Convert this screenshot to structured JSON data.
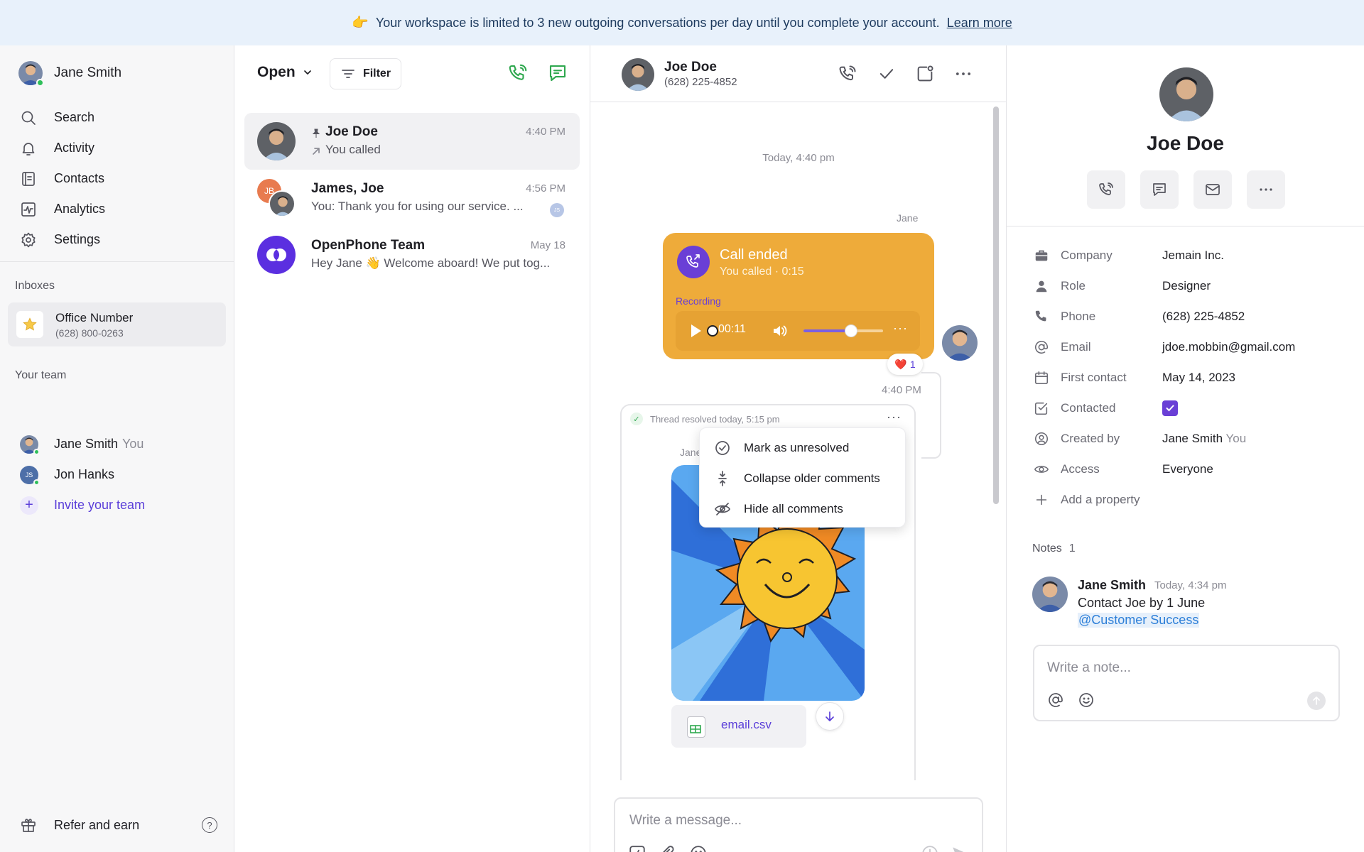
{
  "banner": {
    "emoji": "👉",
    "text": "Your workspace is limited to 3 new outgoing conversations per day until you complete your account.",
    "link": "Learn more"
  },
  "sidebar": {
    "user_name": "Jane Smith",
    "nav": [
      {
        "label": "Search",
        "icon": "search-icon"
      },
      {
        "label": "Activity",
        "icon": "bell-icon"
      },
      {
        "label": "Contacts",
        "icon": "contacts-book-icon"
      },
      {
        "label": "Analytics",
        "icon": "analytics-icon"
      },
      {
        "label": "Settings",
        "icon": "gear-icon"
      }
    ],
    "inboxes_label": "Inboxes",
    "inbox": {
      "name": "Office Number",
      "number": "(628) 800-0263",
      "icon": "star-icon"
    },
    "team_label": "Your team",
    "team": [
      {
        "name": "Jane Smith",
        "suffix": "You",
        "initials": ""
      },
      {
        "name": "Jon Hanks",
        "suffix": "",
        "initials": "JS"
      }
    ],
    "invite_label": "Invite your team",
    "refer_label": "Refer and earn",
    "help_glyph": "?"
  },
  "convlist": {
    "status_label": "Open",
    "filter_label": "Filter",
    "conversations": [
      {
        "name": "Joe Doe",
        "time": "4:40 PM",
        "preview": "You called",
        "pinned": true
      },
      {
        "name": "James, Joe",
        "time": "4:56 PM",
        "preview": "You: Thank you for using our service. ...",
        "initials": "JB",
        "mini_initials": "JS"
      },
      {
        "name": "OpenPhone Team",
        "time": "May 18",
        "preview": "Hey Jane 👋 Welcome aboard! We put tog..."
      }
    ]
  },
  "chat": {
    "contact_name": "Joe Doe",
    "contact_phone": "(628) 225-4852",
    "day_stamp": "Today, 4:40 pm",
    "sender_label": "Jane",
    "call": {
      "title": "Call ended",
      "subtitle": "You called · 0:15",
      "recording_label": "Recording",
      "elapsed": "00:11",
      "progress": 0.0,
      "volume": 0.6
    },
    "reaction": {
      "emoji": "❤️",
      "count": "1"
    },
    "message_time": "4:40 PM",
    "thread": {
      "status": "Thread resolved today, 5:15 pm",
      "sender_label": "Jane",
      "file_name": "email.csv"
    },
    "menu": [
      {
        "label": "Mark as unresolved",
        "icon": "check-circle-icon"
      },
      {
        "label": "Collapse older comments",
        "icon": "collapse-icon"
      },
      {
        "label": "Hide all comments",
        "icon": "eye-off-icon"
      }
    ],
    "composer_placeholder": "Write a message..."
  },
  "contact": {
    "name": "Joe Doe",
    "properties": [
      {
        "label": "Company",
        "value": "Jemain Inc.",
        "icon": "briefcase-icon"
      },
      {
        "label": "Role",
        "value": "Designer",
        "icon": "person-icon"
      },
      {
        "label": "Phone",
        "value": "(628) 225-4852",
        "icon": "phone-icon"
      },
      {
        "label": "Email",
        "value": "jdoe.mobbin@gmail.com",
        "icon": "at-icon"
      },
      {
        "label": "First contact",
        "value": "May 14, 2023",
        "icon": "calendar-icon"
      },
      {
        "label": "Contacted",
        "value": "",
        "checked": true,
        "icon": "checkbox-icon"
      },
      {
        "label": "Created by",
        "value": "Jane Smith",
        "suffix": "You",
        "icon": "user-circle-icon"
      },
      {
        "label": "Access",
        "value": "Everyone",
        "icon": "eye-icon"
      },
      {
        "label": "Add a property",
        "value": "",
        "icon": "plus-icon"
      }
    ],
    "notes_label": "Notes",
    "notes_count": "1",
    "note": {
      "author": "Jane Smith",
      "time": "Today, 4:34 pm",
      "text": "Contact Joe by 1 June",
      "mention": "@Customer Success"
    },
    "note_placeholder": "Write a note..."
  },
  "colors": {
    "accent": "#6a3fd6",
    "call_card": "#eeab3a",
    "online": "#2fbf5a",
    "banner_bg": "#e8f1fb"
  }
}
